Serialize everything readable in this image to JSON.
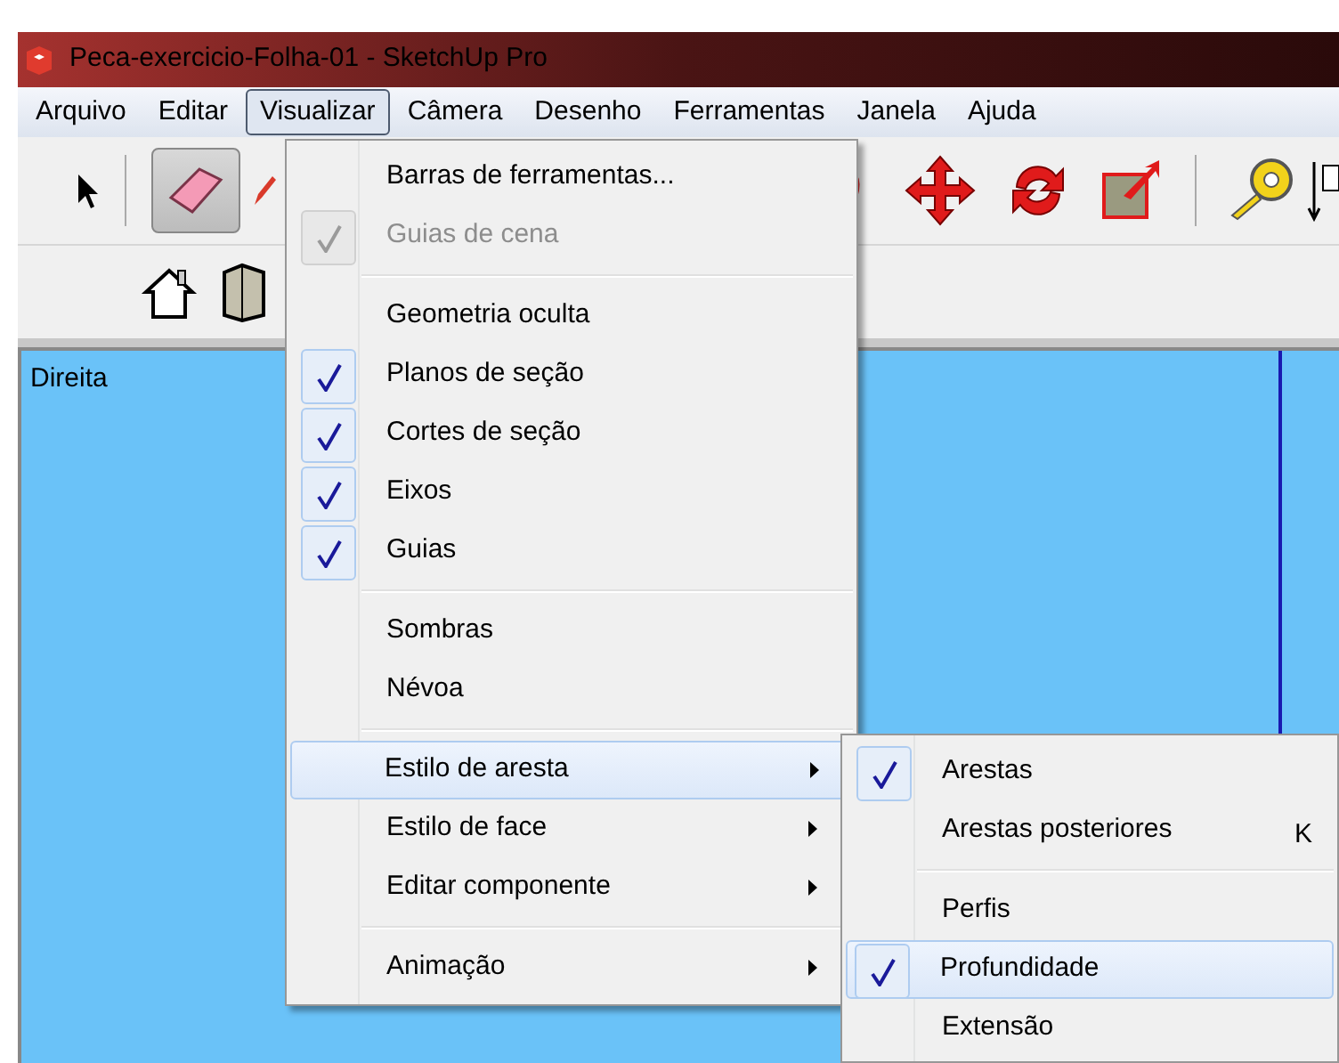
{
  "window": {
    "title": "Peca-exercicio-Folha-01 - SketchUp Pro"
  },
  "menubar": [
    {
      "label": "Arquivo",
      "selected": false
    },
    {
      "label": "Editar",
      "selected": false
    },
    {
      "label": "Visualizar",
      "selected": true
    },
    {
      "label": "Câmera",
      "selected": false
    },
    {
      "label": "Desenho",
      "selected": false
    },
    {
      "label": "Ferramentas",
      "selected": false
    },
    {
      "label": "Janela",
      "selected": false
    },
    {
      "label": "Ajuda",
      "selected": false
    }
  ],
  "viewport": {
    "label": "Direita"
  },
  "menu": [
    {
      "kind": "item",
      "label": "Barras de ferramentas...",
      "checked": false,
      "disabled": false,
      "submenu": false,
      "selected": false
    },
    {
      "kind": "item",
      "label": "Guias de cena",
      "checked": true,
      "disabled": true,
      "submenu": false,
      "selected": false
    },
    {
      "kind": "separator"
    },
    {
      "kind": "item",
      "label": "Geometria oculta",
      "checked": false,
      "disabled": false,
      "submenu": false,
      "selected": false
    },
    {
      "kind": "item",
      "label": "Planos de seção",
      "checked": true,
      "disabled": false,
      "submenu": false,
      "selected": false
    },
    {
      "kind": "item",
      "label": "Cortes de seção",
      "checked": true,
      "disabled": false,
      "submenu": false,
      "selected": false
    },
    {
      "kind": "item",
      "label": "Eixos",
      "checked": true,
      "disabled": false,
      "submenu": false,
      "selected": false
    },
    {
      "kind": "item",
      "label": "Guias",
      "checked": true,
      "disabled": false,
      "submenu": false,
      "selected": false
    },
    {
      "kind": "separator"
    },
    {
      "kind": "item",
      "label": "Sombras",
      "checked": false,
      "disabled": false,
      "submenu": false,
      "selected": false
    },
    {
      "kind": "item",
      "label": "Névoa",
      "checked": false,
      "disabled": false,
      "submenu": false,
      "selected": false
    },
    {
      "kind": "separator"
    },
    {
      "kind": "item",
      "label": "Estilo de aresta",
      "checked": false,
      "disabled": false,
      "submenu": true,
      "selected": true
    },
    {
      "kind": "item",
      "label": "Estilo de face",
      "checked": false,
      "disabled": false,
      "submenu": true,
      "selected": false
    },
    {
      "kind": "item",
      "label": "Editar componente",
      "checked": false,
      "disabled": false,
      "submenu": true,
      "selected": false
    },
    {
      "kind": "separator"
    },
    {
      "kind": "item",
      "label": "Animação",
      "checked": false,
      "disabled": false,
      "submenu": true,
      "selected": false
    }
  ],
  "submenu": [
    {
      "kind": "item",
      "label": "Arestas",
      "checked": true,
      "selected": false
    },
    {
      "kind": "item",
      "label": "Arestas posteriores",
      "checked": false,
      "shortcut": "K",
      "selected": false
    },
    {
      "kind": "separator"
    },
    {
      "kind": "item",
      "label": "Perfis",
      "checked": false,
      "selected": false
    },
    {
      "kind": "item",
      "label": "Profundidade",
      "checked": true,
      "selected": true
    },
    {
      "kind": "item",
      "label": "Extensão",
      "checked": false,
      "selected": false
    }
  ]
}
